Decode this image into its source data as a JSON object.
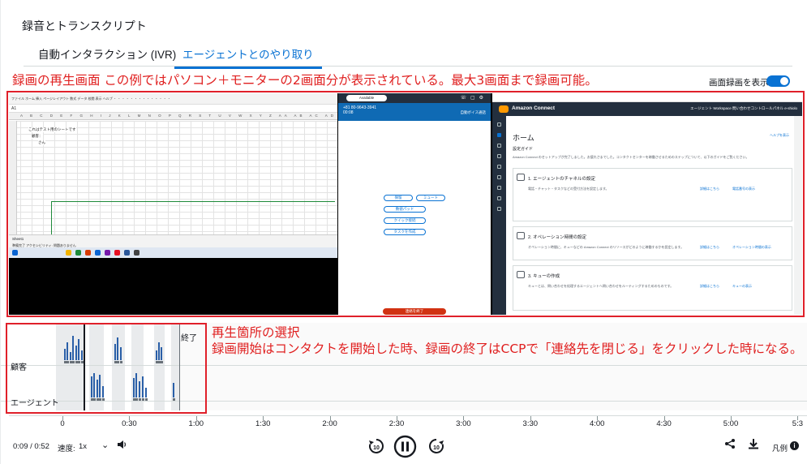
{
  "page": {
    "title": "録音とトランスクリプト"
  },
  "tabs": [
    {
      "label": "自動インタラクション (IVR)",
      "active": false
    },
    {
      "label": "エージェントとのやり取り",
      "active": true
    }
  ],
  "annotations": {
    "screen": "録画の再生画面 この例ではパソコン＋モニターの2画面分が表示されている。最大3画面まで録画可能。",
    "timeline_line1": "再生箇所の選択",
    "timeline_line2": "録画開始はコンタクトを開始した時、録画の終了はCCPで「連絡先を閉じる」をクリックした時になる。"
  },
  "toggle": {
    "label": "画面録画を表示",
    "on": true,
    "color": "#0972d3"
  },
  "screen1": {
    "cell_a1": "A1",
    "text1": "これはテスト用のシートです",
    "text2": "顧客：",
    "text3": "さん",
    "sheet_tab": "Sheet1",
    "status": "準備完了  アクセシビリティ: 問題ありません"
  },
  "screen2": {
    "status": "Available",
    "phone": "+81 80-9643-3941",
    "timer": "00:08",
    "right_label": "自動ボイス通話",
    "buttons": [
      "保留",
      "ミュート",
      "数値パッド",
      "クイック接続",
      "タスクを作成"
    ],
    "end": "連絡を終了"
  },
  "screen3": {
    "brand": "Amazon Connect",
    "nav_links": "エージェント Workspace   問い合わせコントロールパネル   e-shiolo",
    "heading": "ホーム",
    "help": "ヘルプを表示",
    "setup": "設定ガイド",
    "desc": "Amazon Connect のセットアップが完了しました。お疲れさまでした。コンタクトセンターを稼働させるためのステップについて、以下のガイドをご覧ください。",
    "cards": [
      {
        "title": "1. エージェントのチャネルの設定",
        "text": "電話・チャット・タスクなどの受付方法を設定します。",
        "link1": "詳細はこちら",
        "link2": "電話番号の表示"
      },
      {
        "title": "2. オペレーション時間の設定",
        "text": "オペレーション時間に、キューなどの Amazon Connect のリソースがどのように稼働するかを設定します。",
        "link1": "詳細はこちら",
        "link2": "オペレーション時間の表示"
      },
      {
        "title": "3. キューの作成",
        "text": "キューとは、問い合わせを処理するエージェントへ問い合わせをルーティングするためのものです。",
        "link1": "詳細はこちら",
        "link2": "キューの表示"
      }
    ]
  },
  "timeline": {
    "labels": {
      "customer": "顧客",
      "agent": "エージェント",
      "end": "終了"
    },
    "customer_bars": [
      [
        78,
        14
      ],
      [
        81,
        22
      ],
      [
        85,
        10
      ],
      [
        88,
        30
      ],
      [
        92,
        18
      ],
      [
        95,
        26
      ],
      [
        99,
        12
      ],
      [
        140,
        20
      ],
      [
        143,
        28
      ],
      [
        147,
        16
      ],
      [
        191,
        12
      ],
      [
        194,
        22
      ],
      [
        197,
        16
      ]
    ],
    "agent_bars": [
      [
        111,
        26
      ],
      [
        114,
        30
      ],
      [
        118,
        22
      ],
      [
        121,
        28
      ],
      [
        125,
        14
      ],
      [
        163,
        24
      ],
      [
        166,
        30
      ],
      [
        170,
        20
      ],
      [
        174,
        26
      ],
      [
        178,
        12
      ],
      [
        212,
        18
      ]
    ],
    "colors": {
      "bar": "#2a5fa8",
      "playhead": "#16191f",
      "endline": "#687078"
    }
  },
  "axis": {
    "ticks": [
      "0",
      "0:30",
      "1:00",
      "1:30",
      "2:00",
      "2:30",
      "3:00",
      "3:30",
      "4:00",
      "4:30",
      "5:00",
      "5:3"
    ]
  },
  "player": {
    "time": "0:09 / 0:52",
    "speed_label": "速度:",
    "speed": "1x",
    "legend": "凡例",
    "rewind": "10",
    "forward": "10",
    "state": "playing"
  }
}
